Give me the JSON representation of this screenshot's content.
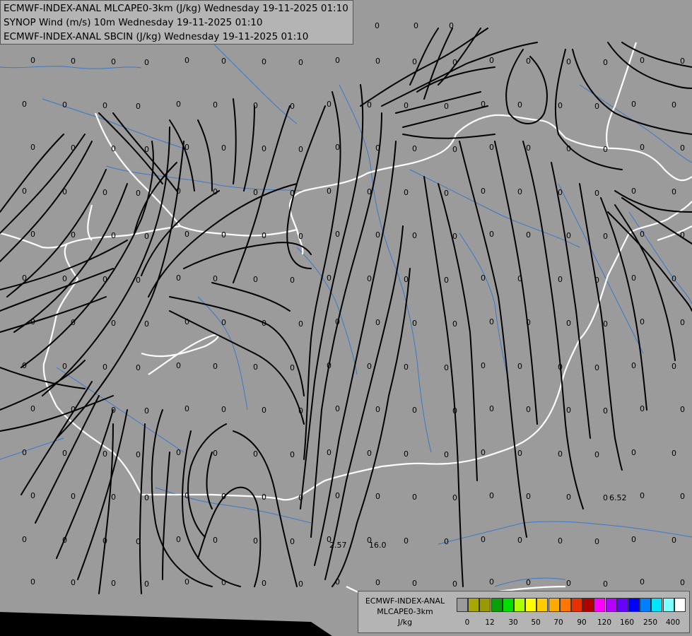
{
  "header": {
    "line1": "ECMWF-INDEX-ANAL MLCAPE0-3km (J/kg) Wednesday 19-11-2025 01:10",
    "line2": "SYNOP Wind (m/s) 10m Wednesday 19-11-2025 01:10",
    "line3": "ECMWF-INDEX-ANAL SBCIN (J/kg) Wednesday 19-11-2025 01:10"
  },
  "legend": {
    "title_line1": "ECMWF-INDEX-ANAL",
    "title_line2": "MLCAPE0-3km",
    "title_line3": "J/kg",
    "colors": [
      "#9b9b9b",
      "#a8a800",
      "#9a9a00",
      "#0aa00a",
      "#00e000",
      "#aaff00",
      "#ffff00",
      "#ffcc00",
      "#ffaa00",
      "#ff7700",
      "#e83000",
      "#b00000",
      "#ff00ff",
      "#b400ff",
      "#6600ff",
      "#0000ff",
      "#0080ff",
      "#00e5ff",
      "#80ffff",
      "#ffffff"
    ],
    "ticks": [
      "0",
      "12",
      "30",
      "50",
      "70",
      "90",
      "120",
      "160",
      "250",
      "400"
    ]
  },
  "map": {
    "background": "#9b9b9b",
    "streamline_color": "#000000",
    "border_color": "#ffffff",
    "river_color": "#3c78c8",
    "station_values": [
      "0",
      "6.52",
      "2.57",
      "16.0"
    ]
  }
}
